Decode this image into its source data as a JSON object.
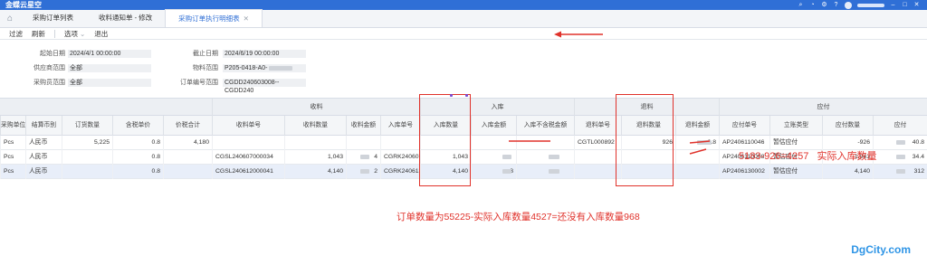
{
  "app": {
    "brand": "金蝶云星空"
  },
  "tabs": [
    {
      "label": "采购订单列表",
      "active": false
    },
    {
      "label": "收料通知单 - 修改",
      "active": false
    },
    {
      "label": "采购订单执行明细表",
      "active": true
    }
  ],
  "toolbar": {
    "filter": "过滤",
    "refresh": "刷新",
    "options": "选项",
    "exit": "退出"
  },
  "filters": {
    "start_date": {
      "label": "起始日期",
      "value": "2024/4/1 00:00:00"
    },
    "end_date": {
      "label": "截止日期",
      "value": "2024/6/19 00:00:00"
    },
    "supplier": {
      "label": "供应商范围",
      "value": "全部"
    },
    "material": {
      "label": "物料范围",
      "value": "P205-0418-A0-"
    },
    "buyer": {
      "label": "采购员范围",
      "value": "全部"
    },
    "order_no": {
      "label": "订单编号范围",
      "value": "CGDD240603008--CGDD240"
    }
  },
  "grid": {
    "groups": {
      "receive": "收料",
      "stock_in": "入库",
      "return": "退料",
      "payable": "应付"
    },
    "columns": [
      "采购单位",
      "结算币别",
      "订货数量",
      "含税单价",
      "价税合计",
      "收料单号",
      "收料数量",
      "收料金额",
      "入库单号",
      "入库数量",
      "入库金额",
      "入库不含税金额",
      "退料单号",
      "退料数量",
      "退料金额",
      "应付单号",
      "立账类型",
      "应付数量",
      "应付"
    ],
    "rows": [
      {
        "unit": "Pcs",
        "currency": "人民币",
        "qty": "5,225",
        "price": "0.8",
        "amount": "4,180",
        "recv_no": "",
        "recv_qty": "",
        "recv_amt": "",
        "in_no": "",
        "in_qty": "",
        "in_amt": "",
        "in_notax": "",
        "ret_no": "CGTL000892",
        "ret_qty": "926",
        "ret_amt": "0.8",
        "ap_no": "AP2406110046",
        "ap_type": "暂估应付",
        "ap_qty": "-926",
        "ap_last": "40.8"
      },
      {
        "unit": "Pcs",
        "currency": "人民币",
        "qty": "",
        "price": "0.8",
        "amount": "",
        "recv_no": "CGSL240607000034",
        "recv_qty": "1,043",
        "recv_amt": "4",
        "in_no": "CGRK240607421",
        "in_qty": "1,043",
        "in_amt": "",
        "in_notax": "",
        "ret_no": "",
        "ret_qty": "",
        "ret_amt": "",
        "ap_no": "AP2406110008",
        "ap_type": "暂估应付",
        "ap_qty": "1,043",
        "ap_last": "34.4"
      },
      {
        "unit": "Pcs",
        "currency": "人民币",
        "qty": "",
        "price": "0.8",
        "amount": "",
        "recv_no": "CGSL240612000041",
        "recv_qty": "4,140",
        "recv_amt": "2",
        "in_no": "CGRK2406132",
        "in_qty": "4,140",
        "in_amt": "3",
        "in_notax": "",
        "ret_no": "",
        "ret_qty": "",
        "ret_amt": "",
        "ap_no": "AP2406130002",
        "ap_type": "暂估应付",
        "ap_qty": "4,140",
        "ap_last": "312"
      }
    ]
  },
  "annotations": {
    "calc": "5183-926=4257",
    "calc_label": "实际入库数量",
    "summary": "订单数量为55225-实际入库数量4527=还没有入库数量968"
  },
  "watermark": "DgCity.com",
  "colors": {
    "header_blue": "#2f6fd6",
    "annotation_red": "#e0322b"
  }
}
